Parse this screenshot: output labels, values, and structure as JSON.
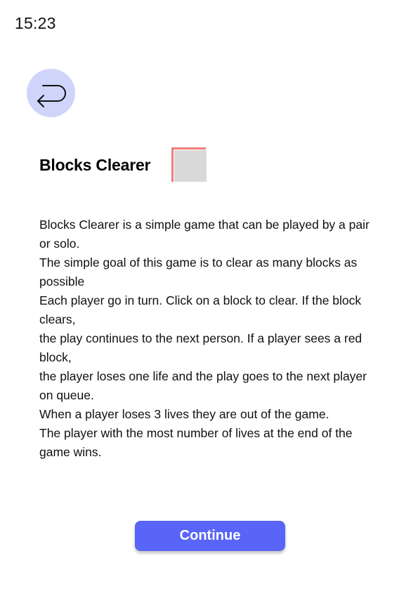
{
  "status_bar": {
    "time": "15:23"
  },
  "header": {
    "back_icon": "return-arrow-icon",
    "back_button_color": "#cfd4fb"
  },
  "main": {
    "title": "Blocks Clearer",
    "title_icon": "block-icon",
    "description_lines": [
      "Blocks Clearer is a simple game that can be played by a pair or solo.",
      "The simple goal of this game is to clear as many blocks as possible",
      "Each player go in turn. Click on a block to clear. If the block clears,",
      "the play continues to the next person. If a player sees a red block,",
      "the player loses one life and the play goes to the next player on queue.",
      "When a player loses 3 lives they are out of the game.",
      "The player with the most number of lives at the end of the game wins."
    ]
  },
  "footer": {
    "continue_label": "Continue",
    "continue_color": "#5865f8"
  },
  "colors": {
    "block_red": "#f07a7a",
    "block_grey": "#d9d9d9"
  }
}
